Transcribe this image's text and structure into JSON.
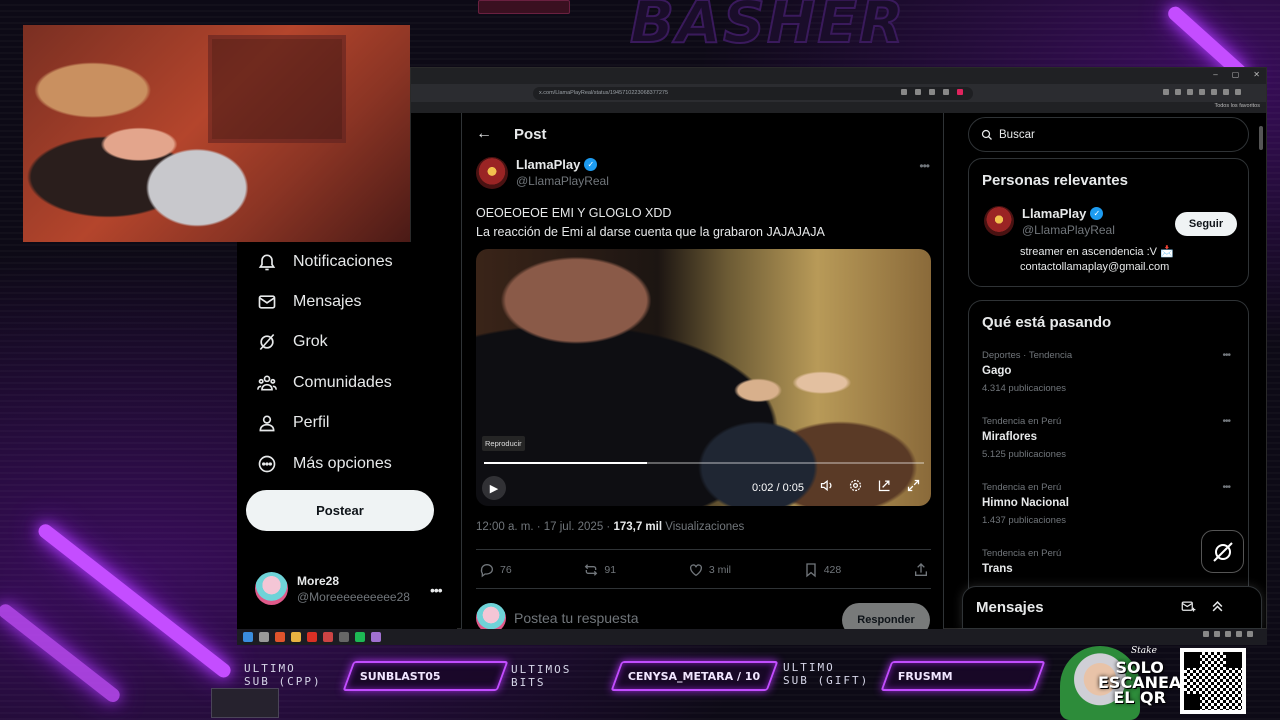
{
  "overlay": {
    "brand": "BASHER",
    "bottom": {
      "last_sub_label": [
        "ULTIMO",
        "SUB (CPP)"
      ],
      "last_sub_value": "SUNBLAST05",
      "last_bits_label": [
        "ULTIMOS",
        "BITS"
      ],
      "last_bits_value": "CENYSA_METARA / 10",
      "last_gift_label": [
        "ULTIMO",
        "SUB (GIFT)"
      ],
      "last_gift_value": "FRUSMM",
      "sponsor_brand": "Stake",
      "qr_text": [
        "SOLO",
        "ESCANEA",
        "EL QR"
      ]
    }
  },
  "browser": {
    "url": "x.com/LlamaPlayReal/status/1945710223068377275",
    "bookmarks_label": "Todos los favoritos",
    "window_controls": [
      "–",
      "▢",
      "✕"
    ]
  },
  "nav": {
    "items": [
      {
        "label": "Notificaciones",
        "icon": "bell-icon"
      },
      {
        "label": "Mensajes",
        "icon": "mail-icon"
      },
      {
        "label": "Grok",
        "icon": "grok-icon"
      },
      {
        "label": "Comunidades",
        "icon": "people-icon"
      },
      {
        "label": "Perfil",
        "icon": "person-icon"
      },
      {
        "label": "Más opciones",
        "icon": "more-circle-icon"
      }
    ],
    "post_button": "Postear",
    "user": {
      "name": "More28",
      "handle": "@Moreeeeeeeeee28"
    }
  },
  "post": {
    "header_title": "Post",
    "author": {
      "name": "LlamaPlay",
      "handle": "@LlamaPlayReal"
    },
    "text_line1": "OEOEOEOE EMI Y GLOGLO XDD",
    "text_line2": "La reacción de Emi al darse cuenta que la grabaron JAJAJAJA",
    "video": {
      "tooltip": "Reproducir",
      "time": "0:02 / 0:05",
      "progress": 0.37
    },
    "meta_time": "12:00 a. m. · 17 jul. 2025 · ",
    "views_count": "173,7 mil",
    "views_label": " Visualizaciones",
    "stats": {
      "replies": "76",
      "reposts": "91",
      "likes": "3 mil",
      "bookmarks": "428"
    },
    "reply_placeholder": "Postea tu respuesta",
    "reply_button": "Responder"
  },
  "sidebar": {
    "search_placeholder": "Buscar",
    "relevant_title": "Personas relevantes",
    "relevant": {
      "name": "LlamaPlay",
      "handle": "@LlamaPlayReal",
      "follow_label": "Seguir",
      "bio_line1": "streamer en ascendencia :V 📩",
      "bio_line2": "contactollamaplay@gmail.com"
    },
    "trending_title": "Qué está pasando",
    "trends": [
      {
        "category": "Deportes · Tendencia",
        "name": "Gago",
        "count": "4.314 publicaciones"
      },
      {
        "category": "Tendencia en Perú",
        "name": "Miraflores",
        "count": "5.125 publicaciones"
      },
      {
        "category": "Tendencia en Perú",
        "name": "Himno Nacional",
        "count": "1.437 publicaciones"
      },
      {
        "category": "Tendencia en Perú",
        "name": "Trans",
        "count": ""
      }
    ],
    "messages_title": "Mensajes"
  },
  "colors": {
    "accent": "#1d9bf0",
    "neon": "#c44dff",
    "background": "#000000"
  }
}
